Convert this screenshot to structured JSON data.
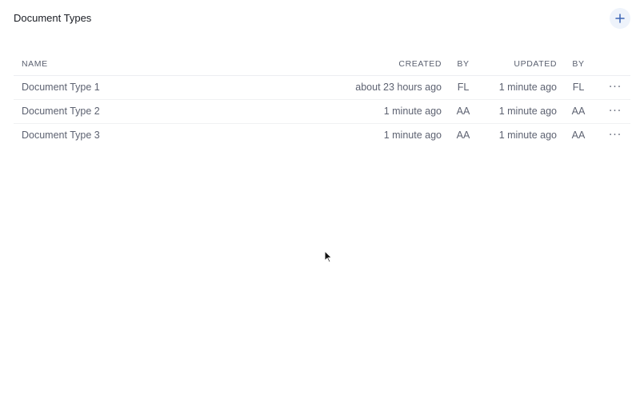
{
  "header": {
    "title": "Document Types",
    "add_icon": "plus-icon",
    "accent_color": "#3b64b4"
  },
  "table": {
    "columns": {
      "name": "NAME",
      "created": "CREATED",
      "created_by": "BY",
      "updated": "UPDATED",
      "updated_by": "BY"
    },
    "rows": [
      {
        "name": "Document Type 1",
        "created": "about 23 hours ago",
        "created_by": "FL",
        "updated": "1 minute ago",
        "updated_by": "FL",
        "menu": "···"
      },
      {
        "name": "Document Type 2",
        "created": "1 minute ago",
        "created_by": "AA",
        "updated": "1 minute ago",
        "updated_by": "AA",
        "menu": "···"
      },
      {
        "name": "Document Type 3",
        "created": "1 minute ago",
        "created_by": "AA",
        "updated": "1 minute ago",
        "updated_by": "AA",
        "menu": "···"
      }
    ]
  }
}
